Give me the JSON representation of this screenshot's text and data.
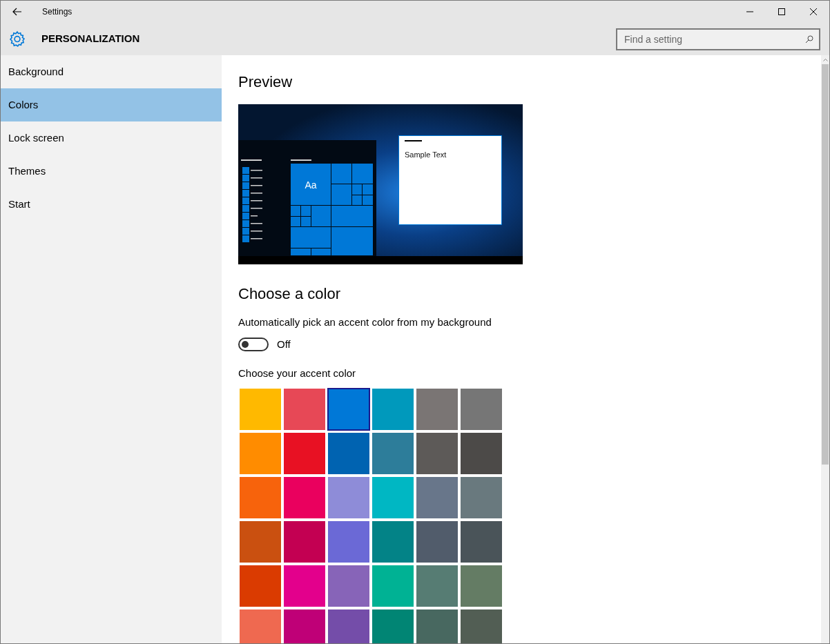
{
  "window": {
    "title": "Settings"
  },
  "header": {
    "title": "PERSONALIZATION",
    "search": {
      "placeholder": "Find a setting"
    }
  },
  "sidebar": {
    "items": [
      {
        "label": "Background",
        "selected": false
      },
      {
        "label": "Colors",
        "selected": true
      },
      {
        "label": "Lock screen",
        "selected": false
      },
      {
        "label": "Themes",
        "selected": false
      },
      {
        "label": "Start",
        "selected": false
      }
    ]
  },
  "preview": {
    "heading": "Preview",
    "tile_label": "Aa",
    "window_text": "Sample Text"
  },
  "choose_color": {
    "heading": "Choose a color",
    "auto_pick": {
      "label": "Automatically pick an accent color from my background",
      "on": false,
      "state_text": "Off"
    },
    "accent_label": "Choose your accent color",
    "swatches": [
      [
        {
          "color": "#ffb900",
          "selected": false
        },
        {
          "color": "#e74856",
          "selected": false
        },
        {
          "color": "#0078d7",
          "selected": true
        },
        {
          "color": "#0099bc",
          "selected": false
        },
        {
          "color": "#7a7574",
          "selected": false
        },
        {
          "color": "#767676",
          "selected": false
        }
      ],
      [
        {
          "color": "#ff8c00",
          "selected": false
        },
        {
          "color": "#e81123",
          "selected": false
        },
        {
          "color": "#0063b1",
          "selected": false
        },
        {
          "color": "#2d7d9a",
          "selected": false
        },
        {
          "color": "#5d5a58",
          "selected": false
        },
        {
          "color": "#4c4a48",
          "selected": false
        }
      ],
      [
        {
          "color": "#f7630c",
          "selected": false
        },
        {
          "color": "#ea005e",
          "selected": false
        },
        {
          "color": "#8e8cd8",
          "selected": false
        },
        {
          "color": "#00b7c3",
          "selected": false
        },
        {
          "color": "#68768a",
          "selected": false
        },
        {
          "color": "#69797e",
          "selected": false
        }
      ],
      [
        {
          "color": "#ca5010",
          "selected": false
        },
        {
          "color": "#c30052",
          "selected": false
        },
        {
          "color": "#6b69d6",
          "selected": false
        },
        {
          "color": "#038387",
          "selected": false
        },
        {
          "color": "#515c6b",
          "selected": false
        },
        {
          "color": "#4a5459",
          "selected": false
        }
      ],
      [
        {
          "color": "#da3b01",
          "selected": false
        },
        {
          "color": "#e3008c",
          "selected": false
        },
        {
          "color": "#8764b8",
          "selected": false
        },
        {
          "color": "#00b294",
          "selected": false
        },
        {
          "color": "#567c73",
          "selected": false
        },
        {
          "color": "#647c64",
          "selected": false
        }
      ],
      [
        {
          "color": "#ef6950",
          "selected": false
        },
        {
          "color": "#bf0077",
          "selected": false
        },
        {
          "color": "#744da9",
          "selected": false
        },
        {
          "color": "#018574",
          "selected": false
        },
        {
          "color": "#486860",
          "selected": false
        },
        {
          "color": "#525e54",
          "selected": false
        }
      ]
    ]
  }
}
